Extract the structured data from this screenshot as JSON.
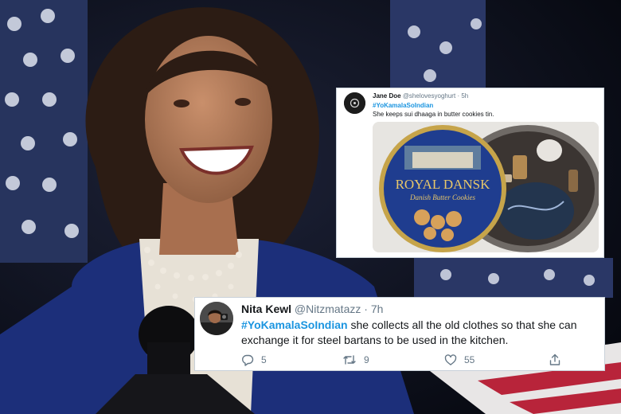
{
  "tweets": [
    {
      "name": "Jane Doe",
      "handle": "@shelovesyoghurt",
      "separator": "·",
      "time": "5h",
      "hashtag": "#YoKamalaSoIndian",
      "text": "She keeps sui dhaaga in butter cookies tin.",
      "image": {
        "tin_brand": "ROYAL DANSK",
        "tin_subtitle": "Danish Butter Cookies"
      }
    },
    {
      "name": "Nita Kewl",
      "handle": "@Nitzmatazz",
      "separator": "·",
      "time": "7h",
      "hashtag": "#YoKamalaSoIndian",
      "text": " she collects all the old clothes so that she can exchange it for steel bartans to be used in the kitchen.",
      "actions": {
        "replies": "5",
        "retweets": "9",
        "likes": "55"
      }
    }
  ],
  "colors": {
    "hashtag": "#1b95e0",
    "muted": "#657786",
    "suit": "#1c2f7a",
    "tin_blue": "#1f3d8f"
  },
  "icons": [
    "reply-icon",
    "retweet-icon",
    "like-icon",
    "share-icon"
  ]
}
